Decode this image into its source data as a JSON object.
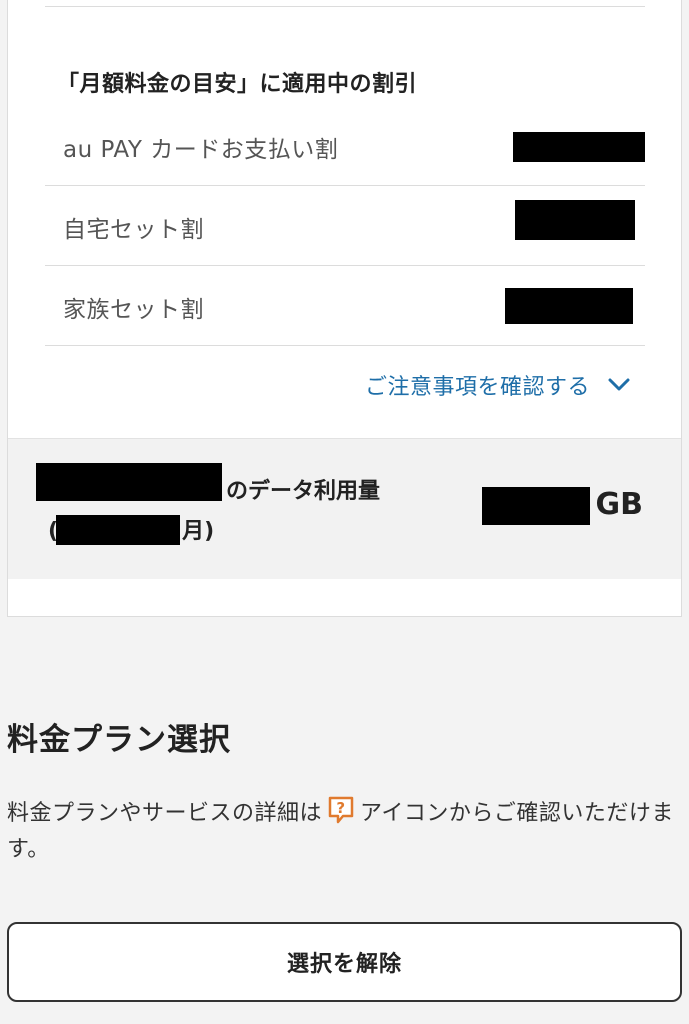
{
  "discounts": {
    "heading": "「月額料金の目安」に適用中の割引",
    "items": [
      {
        "label": "au PAY カードお支払い割"
      },
      {
        "label": "自宅セット割"
      },
      {
        "label": "家族セット割"
      }
    ],
    "notes_link": "ご注意事項を確認する"
  },
  "usage": {
    "label_suffix": "のデータ利用量",
    "period_open": "(",
    "period_close": "月)",
    "value_unit": "GB"
  },
  "plan_select": {
    "title": "料金プラン選択",
    "desc_before_icon": "料金プランやサービスの詳細は",
    "desc_after_icon": "アイコンからご確認いただけます。",
    "clear_button": "選択を解除"
  },
  "colors": {
    "link": "#1e6ea8",
    "help_icon": "#e07a2e",
    "background": "#f3f3f3"
  },
  "icons": {
    "notes_toggle": "chevron-down-icon",
    "help": "question-bubble-icon"
  }
}
